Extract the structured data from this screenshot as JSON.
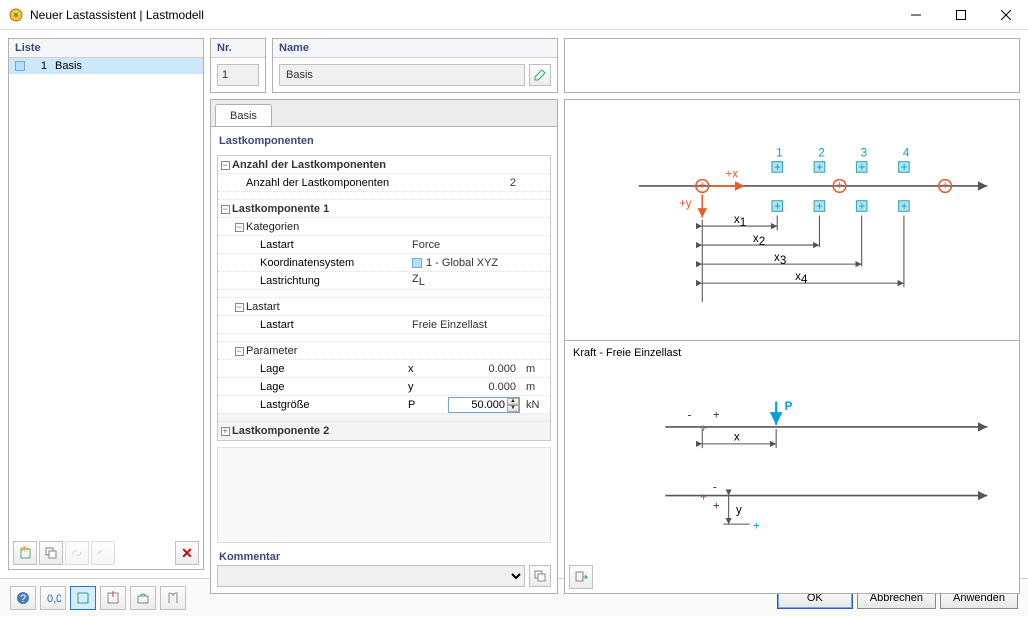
{
  "window": {
    "title": "Neuer Lastassistent | Lastmodell"
  },
  "list": {
    "header": "Liste",
    "items": [
      {
        "num": "1",
        "label": "Basis"
      }
    ]
  },
  "nr": {
    "header": "Nr.",
    "value": "1"
  },
  "name": {
    "header": "Name",
    "value": "Basis"
  },
  "tabs": {
    "basis": "Basis"
  },
  "sections": {
    "lastkomponenten": "Lastkomponenten",
    "anzahl_group": "Anzahl der Lastkomponenten",
    "anzahl_label": "Anzahl der Lastkomponenten",
    "anzahl_value": "2",
    "lk1": "Lastkomponente 1",
    "kategorien": "Kategorien",
    "lastart_label": "Lastart",
    "lastart_value": "Force",
    "koord_label": "Koordinatensystem",
    "koord_value": "1 - Global XYZ",
    "lastrichtung_label": "Lastrichtung",
    "lastrichtung_value": "Z",
    "lastrichtung_sub": "L",
    "lastart2_group": "Lastart",
    "lastart2_label": "Lastart",
    "lastart2_value": "Freie Einzellast",
    "parameter": "Parameter",
    "lage1_label": "Lage",
    "lage1_sym": "x",
    "lage1_val": "0.000",
    "lage1_unit": "m",
    "lage2_label": "Lage",
    "lage2_sym": "y",
    "lage2_val": "0.000",
    "lage2_unit": "m",
    "groesse_label": "Lastgröße",
    "groesse_sym": "P",
    "groesse_val": "50.000",
    "groesse_unit": "kN",
    "lk2": "Lastkomponente 2"
  },
  "kommentar": {
    "header": "Kommentar"
  },
  "diagram": {
    "bottom_label": "Kraft - Freie Einzellast",
    "top": {
      "n1": "1",
      "n2": "2",
      "n3": "3",
      "n4": "4",
      "px": "+x",
      "py": "+y",
      "x1": "x",
      "x1s": "1",
      "x2": "x",
      "x2s": "2",
      "x3": "x",
      "x3s": "3",
      "x4": "x",
      "x4s": "4"
    },
    "bot": {
      "P": "P",
      "x": "x",
      "y": "y",
      "plus": "+",
      "minus": "-"
    }
  },
  "buttons": {
    "ok": "OK",
    "cancel": "Abbrechen",
    "apply": "Anwenden"
  }
}
